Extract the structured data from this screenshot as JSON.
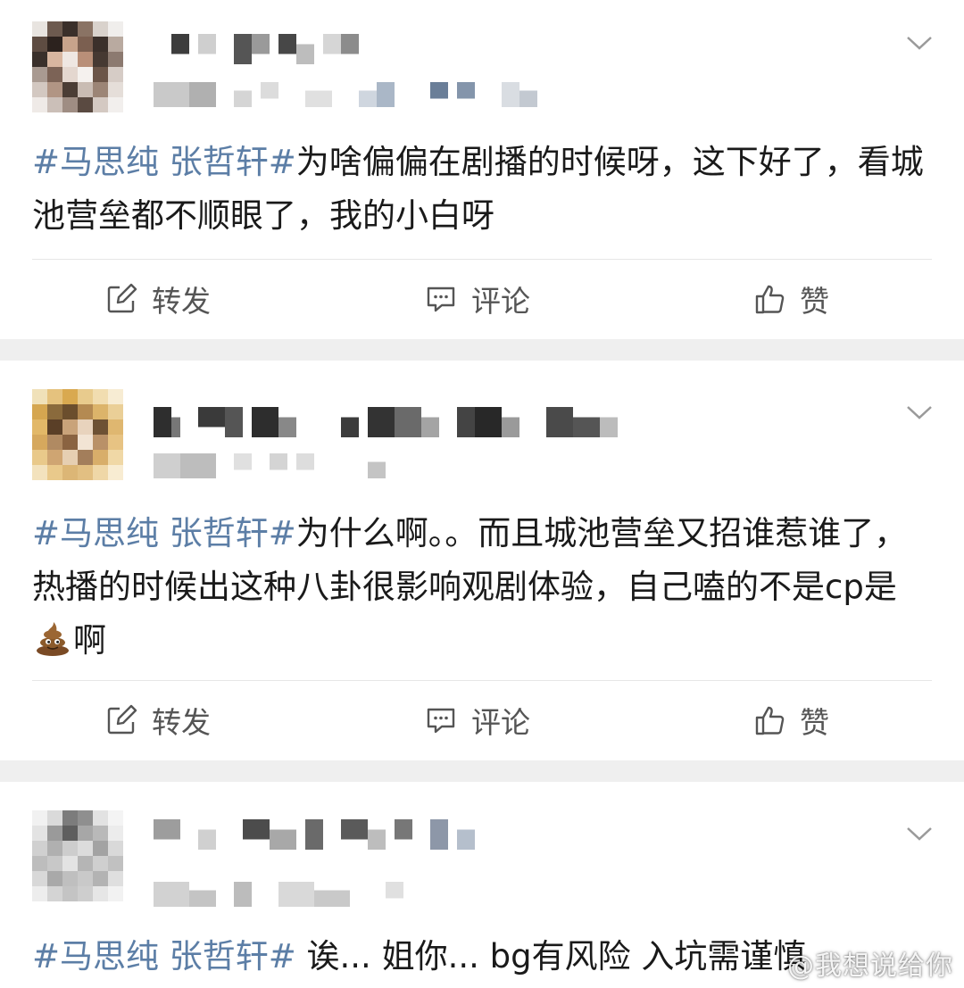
{
  "posts": [
    {
      "topic": "#马思纯 张哲轩#",
      "text": "为啥偏偏在剧播的时候呀，这下好了，看城池营垒都不顺眼了，我的小白呀",
      "actions": {
        "repost": "转发",
        "comment": "评论",
        "like": "赞"
      }
    },
    {
      "topic": "#马思纯 张哲轩#",
      "text": "为什么啊。。而且城池营垒又招谁惹谁了，热播的时候出这种八卦很影响观剧体验，自己嗑的不是cp是",
      "text_after_emoji": "啊",
      "emoji": "poop-emoji",
      "actions": {
        "repost": "转发",
        "comment": "评论",
        "like": "赞"
      }
    },
    {
      "topic": "#马思纯 张哲轩#",
      "text": " 诶... 姐你... bg有风险 入坑需谨慎"
    }
  ],
  "watermark": "@我想说给你",
  "icons": {
    "repost": "edit-square-icon",
    "comment": "comment-bubble-icon",
    "like": "thumbs-up-icon",
    "menu": "chevron-down-icon"
  },
  "colors": {
    "topic": "#5c7ea6",
    "text": "#1a1a1a",
    "action": "#555555",
    "separator": "#efefef"
  }
}
